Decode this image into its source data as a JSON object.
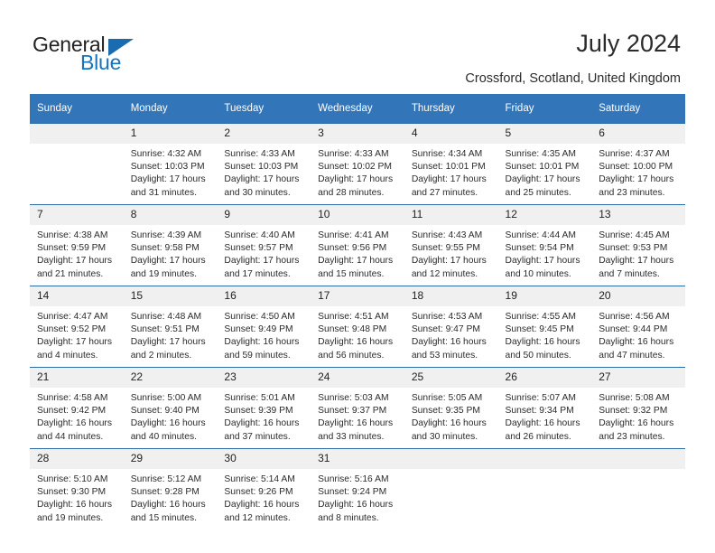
{
  "brand": {
    "word1": "General",
    "word2": "Blue",
    "logo_icon": "triangle-logo-icon",
    "blue": "#1673bc"
  },
  "header": {
    "title": "July 2024",
    "subtitle": "Crossford, Scotland, United Kingdom",
    "accent": "#3275b8"
  },
  "weekday_headers": [
    "Sunday",
    "Monday",
    "Tuesday",
    "Wednesday",
    "Thursday",
    "Friday",
    "Saturday"
  ],
  "labels": {
    "sunrise": "Sunrise:",
    "sunset": "Sunset:",
    "daylight": "Daylight:"
  },
  "weeks": [
    [
      {
        "day": "",
        "sunrise": "",
        "sunset": "",
        "daylight_1": "",
        "daylight_2": ""
      },
      {
        "day": "1",
        "sunrise": "Sunrise: 4:32 AM",
        "sunset": "Sunset: 10:03 PM",
        "daylight_1": "Daylight: 17 hours",
        "daylight_2": "and 31 minutes."
      },
      {
        "day": "2",
        "sunrise": "Sunrise: 4:33 AM",
        "sunset": "Sunset: 10:03 PM",
        "daylight_1": "Daylight: 17 hours",
        "daylight_2": "and 30 minutes."
      },
      {
        "day": "3",
        "sunrise": "Sunrise: 4:33 AM",
        "sunset": "Sunset: 10:02 PM",
        "daylight_1": "Daylight: 17 hours",
        "daylight_2": "and 28 minutes."
      },
      {
        "day": "4",
        "sunrise": "Sunrise: 4:34 AM",
        "sunset": "Sunset: 10:01 PM",
        "daylight_1": "Daylight: 17 hours",
        "daylight_2": "and 27 minutes."
      },
      {
        "day": "5",
        "sunrise": "Sunrise: 4:35 AM",
        "sunset": "Sunset: 10:01 PM",
        "daylight_1": "Daylight: 17 hours",
        "daylight_2": "and 25 minutes."
      },
      {
        "day": "6",
        "sunrise": "Sunrise: 4:37 AM",
        "sunset": "Sunset: 10:00 PM",
        "daylight_1": "Daylight: 17 hours",
        "daylight_2": "and 23 minutes."
      }
    ],
    [
      {
        "day": "7",
        "sunrise": "Sunrise: 4:38 AM",
        "sunset": "Sunset: 9:59 PM",
        "daylight_1": "Daylight: 17 hours",
        "daylight_2": "and 21 minutes."
      },
      {
        "day": "8",
        "sunrise": "Sunrise: 4:39 AM",
        "sunset": "Sunset: 9:58 PM",
        "daylight_1": "Daylight: 17 hours",
        "daylight_2": "and 19 minutes."
      },
      {
        "day": "9",
        "sunrise": "Sunrise: 4:40 AM",
        "sunset": "Sunset: 9:57 PM",
        "daylight_1": "Daylight: 17 hours",
        "daylight_2": "and 17 minutes."
      },
      {
        "day": "10",
        "sunrise": "Sunrise: 4:41 AM",
        "sunset": "Sunset: 9:56 PM",
        "daylight_1": "Daylight: 17 hours",
        "daylight_2": "and 15 minutes."
      },
      {
        "day": "11",
        "sunrise": "Sunrise: 4:43 AM",
        "sunset": "Sunset: 9:55 PM",
        "daylight_1": "Daylight: 17 hours",
        "daylight_2": "and 12 minutes."
      },
      {
        "day": "12",
        "sunrise": "Sunrise: 4:44 AM",
        "sunset": "Sunset: 9:54 PM",
        "daylight_1": "Daylight: 17 hours",
        "daylight_2": "and 10 minutes."
      },
      {
        "day": "13",
        "sunrise": "Sunrise: 4:45 AM",
        "sunset": "Sunset: 9:53 PM",
        "daylight_1": "Daylight: 17 hours",
        "daylight_2": "and 7 minutes."
      }
    ],
    [
      {
        "day": "14",
        "sunrise": "Sunrise: 4:47 AM",
        "sunset": "Sunset: 9:52 PM",
        "daylight_1": "Daylight: 17 hours",
        "daylight_2": "and 4 minutes."
      },
      {
        "day": "15",
        "sunrise": "Sunrise: 4:48 AM",
        "sunset": "Sunset: 9:51 PM",
        "daylight_1": "Daylight: 17 hours",
        "daylight_2": "and 2 minutes."
      },
      {
        "day": "16",
        "sunrise": "Sunrise: 4:50 AM",
        "sunset": "Sunset: 9:49 PM",
        "daylight_1": "Daylight: 16 hours",
        "daylight_2": "and 59 minutes."
      },
      {
        "day": "17",
        "sunrise": "Sunrise: 4:51 AM",
        "sunset": "Sunset: 9:48 PM",
        "daylight_1": "Daylight: 16 hours",
        "daylight_2": "and 56 minutes."
      },
      {
        "day": "18",
        "sunrise": "Sunrise: 4:53 AM",
        "sunset": "Sunset: 9:47 PM",
        "daylight_1": "Daylight: 16 hours",
        "daylight_2": "and 53 minutes."
      },
      {
        "day": "19",
        "sunrise": "Sunrise: 4:55 AM",
        "sunset": "Sunset: 9:45 PM",
        "daylight_1": "Daylight: 16 hours",
        "daylight_2": "and 50 minutes."
      },
      {
        "day": "20",
        "sunrise": "Sunrise: 4:56 AM",
        "sunset": "Sunset: 9:44 PM",
        "daylight_1": "Daylight: 16 hours",
        "daylight_2": "and 47 minutes."
      }
    ],
    [
      {
        "day": "21",
        "sunrise": "Sunrise: 4:58 AM",
        "sunset": "Sunset: 9:42 PM",
        "daylight_1": "Daylight: 16 hours",
        "daylight_2": "and 44 minutes."
      },
      {
        "day": "22",
        "sunrise": "Sunrise: 5:00 AM",
        "sunset": "Sunset: 9:40 PM",
        "daylight_1": "Daylight: 16 hours",
        "daylight_2": "and 40 minutes."
      },
      {
        "day": "23",
        "sunrise": "Sunrise: 5:01 AM",
        "sunset": "Sunset: 9:39 PM",
        "daylight_1": "Daylight: 16 hours",
        "daylight_2": "and 37 minutes."
      },
      {
        "day": "24",
        "sunrise": "Sunrise: 5:03 AM",
        "sunset": "Sunset: 9:37 PM",
        "daylight_1": "Daylight: 16 hours",
        "daylight_2": "and 33 minutes."
      },
      {
        "day": "25",
        "sunrise": "Sunrise: 5:05 AM",
        "sunset": "Sunset: 9:35 PM",
        "daylight_1": "Daylight: 16 hours",
        "daylight_2": "and 30 minutes."
      },
      {
        "day": "26",
        "sunrise": "Sunrise: 5:07 AM",
        "sunset": "Sunset: 9:34 PM",
        "daylight_1": "Daylight: 16 hours",
        "daylight_2": "and 26 minutes."
      },
      {
        "day": "27",
        "sunrise": "Sunrise: 5:08 AM",
        "sunset": "Sunset: 9:32 PM",
        "daylight_1": "Daylight: 16 hours",
        "daylight_2": "and 23 minutes."
      }
    ],
    [
      {
        "day": "28",
        "sunrise": "Sunrise: 5:10 AM",
        "sunset": "Sunset: 9:30 PM",
        "daylight_1": "Daylight: 16 hours",
        "daylight_2": "and 19 minutes."
      },
      {
        "day": "29",
        "sunrise": "Sunrise: 5:12 AM",
        "sunset": "Sunset: 9:28 PM",
        "daylight_1": "Daylight: 16 hours",
        "daylight_2": "and 15 minutes."
      },
      {
        "day": "30",
        "sunrise": "Sunrise: 5:14 AM",
        "sunset": "Sunset: 9:26 PM",
        "daylight_1": "Daylight: 16 hours",
        "daylight_2": "and 12 minutes."
      },
      {
        "day": "31",
        "sunrise": "Sunrise: 5:16 AM",
        "sunset": "Sunset: 9:24 PM",
        "daylight_1": "Daylight: 16 hours",
        "daylight_2": "and 8 minutes."
      },
      {
        "day": "",
        "sunrise": "",
        "sunset": "",
        "daylight_1": "",
        "daylight_2": ""
      },
      {
        "day": "",
        "sunrise": "",
        "sunset": "",
        "daylight_1": "",
        "daylight_2": ""
      },
      {
        "day": "",
        "sunrise": "",
        "sunset": "",
        "daylight_1": "",
        "daylight_2": ""
      }
    ]
  ]
}
